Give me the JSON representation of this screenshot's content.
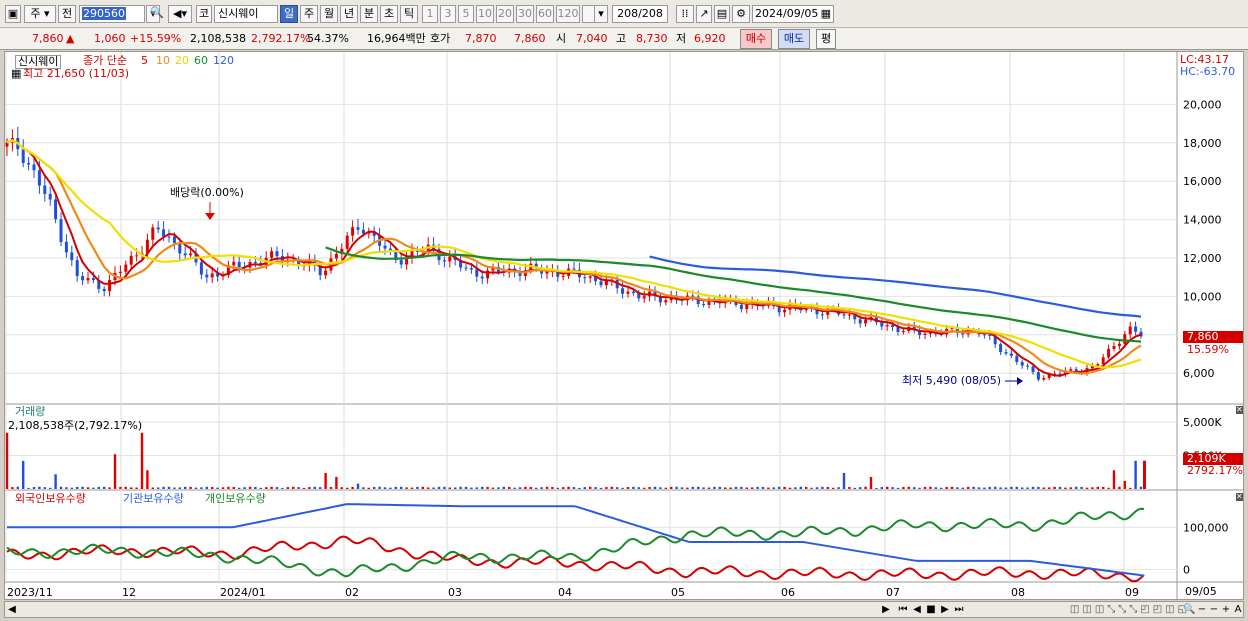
{
  "toolbar": {
    "market": "주",
    "prev_label": "전",
    "stock_code": "290560",
    "code_label": "코",
    "stock_name": "신시웨이",
    "periods": [
      "일",
      "주",
      "월",
      "년",
      "분",
      "초",
      "틱"
    ],
    "selected_period": "일",
    "intervals": [
      "1",
      "3",
      "5",
      "10",
      "20",
      "30",
      "60",
      "120"
    ],
    "count": "208",
    "count_total": "/208",
    "date": "2024/09/05"
  },
  "quote": {
    "price": "7,860",
    "change_arrow": "▲",
    "change": "1,060",
    "change_pct": "+15.59%",
    "volume": "2,108,538",
    "volume_ratio": "2,792.17%",
    "turnover": "54.37%",
    "amount": "16,964백만",
    "hoga_label": "호가",
    "ask": "7,870",
    "bid": "7,860",
    "open_label": "시",
    "open": "7,040",
    "high_label": "고",
    "high": "8,730",
    "low_label": "저",
    "low": "6,920",
    "buy_button": "매수",
    "sell_button": "매도",
    "eval_button": "평"
  },
  "chart_labels": {
    "legend_name": "신시웨이",
    "legend_ma_title": "종가 단순",
    "ma_periods": [
      "5",
      "10",
      "20",
      "60",
      "120"
    ],
    "ma_colors": [
      "#d40000",
      "#ee8a1c",
      "#f0e000",
      "#1a8a2a",
      "#2b5ce0"
    ],
    "high_note": "최고 21,650 (11/03)",
    "low_note": "최저 5,490 (08/05)",
    "dividend_note": "배당락(0.00%)",
    "lc": "LC:43.17",
    "hc": "HC:-63.70",
    "last_price": "7,860",
    "last_pct": "15.59%",
    "volume_title": "거래량",
    "volume_note": "2,108,538주(2,792.17%)",
    "volume_last": "2,109K",
    "volume_pct": "2792.17%",
    "holdings": [
      "외국인보유수량",
      "기관보유수량",
      "개인보유수량"
    ],
    "holding_colors": [
      "#d40000",
      "#2b5ce0",
      "#1a8a2a"
    ],
    "date_right": "09/05"
  },
  "chart_data": [
    {
      "type": "candlestick",
      "title": "신시웨이",
      "x": [
        "2023/11",
        "12",
        "2024/01",
        "02",
        "03",
        "04",
        "05",
        "06",
        "07",
        "08",
        "09"
      ],
      "y_ticks": [
        6000,
        8000,
        10000,
        12000,
        14000,
        16000,
        18000,
        20000
      ],
      "ylim": [
        4500,
        22000
      ],
      "moving_averages": [
        "5",
        "10",
        "20",
        "60",
        "120"
      ],
      "close_path": [
        {
          "x": "2023/11",
          "y": 17800
        },
        {
          "x": "2023/11",
          "y": 15000
        },
        {
          "x": "2023/11",
          "y": 11000
        },
        {
          "x": "2023/11",
          "y": 10500
        },
        {
          "x": "12",
          "y": 12000
        },
        {
          "x": "12",
          "y": 13500
        },
        {
          "x": "12",
          "y": 12500
        },
        {
          "x": "12",
          "y": 11000
        },
        {
          "x": "2024/01",
          "y": 11600
        },
        {
          "x": "2024/01",
          "y": 12100
        },
        {
          "x": "2024/01",
          "y": 11300
        },
        {
          "x": "02",
          "y": 13800
        },
        {
          "x": "02",
          "y": 11900
        },
        {
          "x": "02",
          "y": 12500
        },
        {
          "x": "03",
          "y": 11200
        },
        {
          "x": "03",
          "y": 11400
        },
        {
          "x": "04",
          "y": 11100
        },
        {
          "x": "04",
          "y": 10000
        },
        {
          "x": "05",
          "y": 9700
        },
        {
          "x": "06",
          "y": 9200
        },
        {
          "x": "07",
          "y": 8100
        },
        {
          "x": "07",
          "y": 8200
        },
        {
          "x": "08",
          "y": 5800
        },
        {
          "x": "08",
          "y": 6300
        },
        {
          "x": "09",
          "y": 8300
        },
        {
          "x": "09",
          "y": 7860
        }
      ]
    },
    {
      "type": "bar",
      "title": "거래량",
      "y_ticks": [
        2500,
        5000
      ],
      "unit": "K",
      "ylim": [
        0,
        5600
      ],
      "last_value": 2109
    },
    {
      "type": "line",
      "y_ticks": [
        0,
        100000
      ],
      "series": [
        {
          "name": "외국인보유수량",
          "values": [
            32000,
            45000,
            38000,
            70000,
            20000,
            15000,
            -5000,
            -10000,
            -12000,
            -8000,
            -15000
          ]
        },
        {
          "name": "기관보유수량",
          "values": [
            100000,
            100000,
            100000,
            155000,
            150000,
            150000,
            65000,
            65000,
            20000,
            20000,
            -15000
          ]
        },
        {
          "name": "개인보유수량",
          "values": [
            40000,
            45000,
            30000,
            -10000,
            30000,
            30000,
            85000,
            85000,
            105000,
            105000,
            140000
          ]
        }
      ]
    }
  ]
}
